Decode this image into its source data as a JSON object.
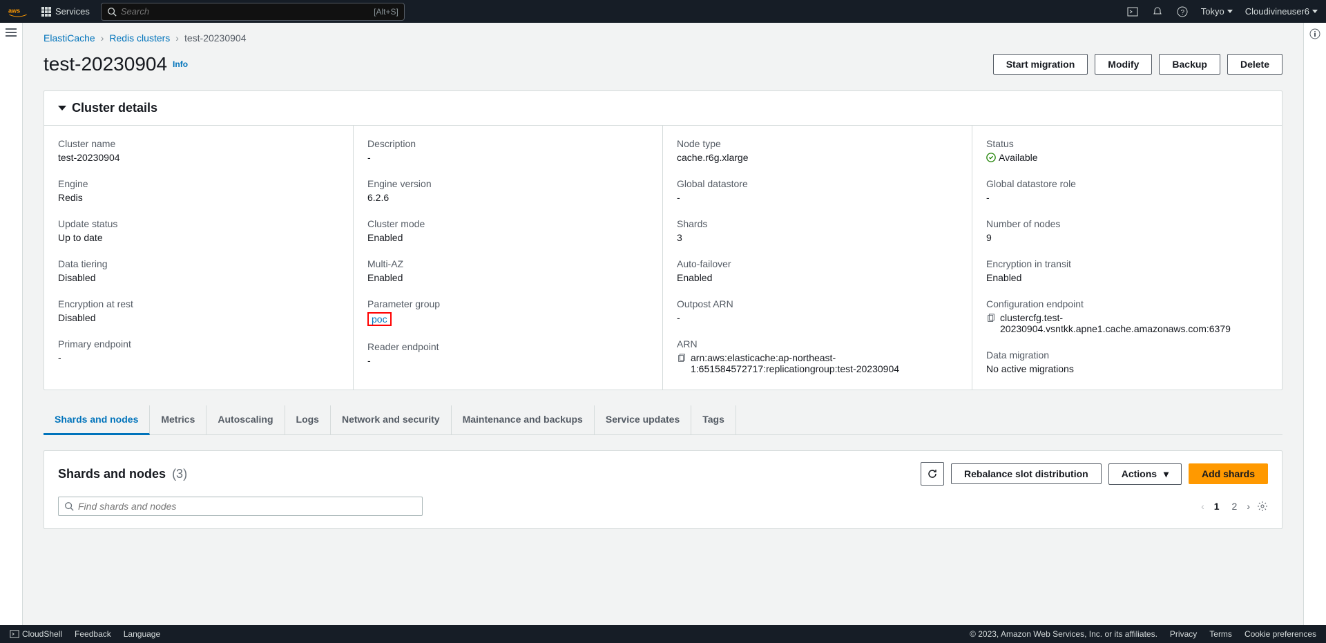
{
  "nav": {
    "services": "Services",
    "search_placeholder": "Search",
    "search_hint": "[Alt+S]",
    "region": "Tokyo",
    "user": "Cloudivineuser6"
  },
  "breadcrumb": {
    "root": "ElastiCache",
    "mid": "Redis clusters",
    "leaf": "test-20230904"
  },
  "page": {
    "title": "test-20230904",
    "info": "Info"
  },
  "actions": {
    "start_migration": "Start migration",
    "modify": "Modify",
    "backup": "Backup",
    "delete": "Delete"
  },
  "cluster_details": {
    "heading": "Cluster details",
    "cluster_name_lbl": "Cluster name",
    "cluster_name": "test-20230904",
    "description_lbl": "Description",
    "description": "-",
    "node_type_lbl": "Node type",
    "node_type": "cache.r6g.xlarge",
    "status_lbl": "Status",
    "status": "Available",
    "engine_lbl": "Engine",
    "engine": "Redis",
    "engine_version_lbl": "Engine version",
    "engine_version": "6.2.6",
    "global_ds_lbl": "Global datastore",
    "global_ds": "-",
    "global_ds_role_lbl": "Global datastore role",
    "global_ds_role": "-",
    "update_status_lbl": "Update status",
    "update_status": "Up to date",
    "cluster_mode_lbl": "Cluster mode",
    "cluster_mode": "Enabled",
    "shards_lbl": "Shards",
    "shards": "3",
    "num_nodes_lbl": "Number of nodes",
    "num_nodes": "9",
    "data_tiering_lbl": "Data tiering",
    "data_tiering": "Disabled",
    "multi_az_lbl": "Multi-AZ",
    "multi_az": "Enabled",
    "auto_failover_lbl": "Auto-failover",
    "auto_failover": "Enabled",
    "enc_transit_lbl": "Encryption in transit",
    "enc_transit": "Enabled",
    "enc_rest_lbl": "Encryption at rest",
    "enc_rest": "Disabled",
    "param_group_lbl": "Parameter group",
    "param_group": "poc",
    "outpost_arn_lbl": "Outpost ARN",
    "outpost_arn": "-",
    "cfg_endpoint_lbl": "Configuration endpoint",
    "cfg_endpoint": "clustercfg.test-20230904.vsntkk.apne1.cache.amazonaws.com:6379",
    "primary_ep_lbl": "Primary endpoint",
    "primary_ep": "-",
    "reader_ep_lbl": "Reader endpoint",
    "reader_ep": "-",
    "arn_lbl": "ARN",
    "arn": "arn:aws:elasticache:ap-northeast-1:651584572717:replicationgroup:test-20230904",
    "data_migration_lbl": "Data migration",
    "data_migration": "No active migrations"
  },
  "tabs": {
    "shards": "Shards and nodes",
    "metrics": "Metrics",
    "autoscaling": "Autoscaling",
    "logs": "Logs",
    "network": "Network and security",
    "maintenance": "Maintenance and backups",
    "service_updates": "Service updates",
    "tags": "Tags"
  },
  "shards_panel": {
    "title": "Shards and nodes",
    "count": "(3)",
    "rebalance": "Rebalance slot distribution",
    "actions": "Actions",
    "add": "Add shards",
    "filter_placeholder": "Find shards and nodes",
    "page1": "1",
    "page2": "2"
  },
  "footer": {
    "cloudshell": "CloudShell",
    "feedback": "Feedback",
    "language": "Language",
    "copyright": "© 2023, Amazon Web Services, Inc. or its affiliates.",
    "privacy": "Privacy",
    "terms": "Terms",
    "cookies": "Cookie preferences"
  }
}
